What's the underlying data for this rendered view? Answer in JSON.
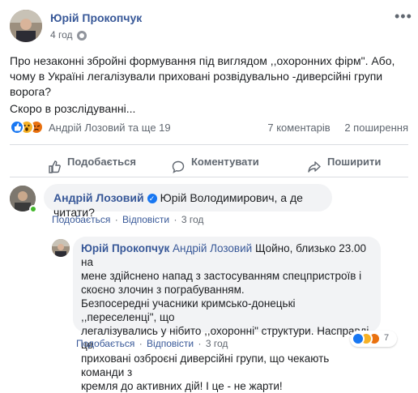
{
  "post": {
    "author": "Юрій Прокопчук",
    "time": "4 год",
    "text_lines": [
      "Про незаконні збройні формування під виглядом ,,охоронних фірм\". Або,",
      "чому в Україні легалізували приховані розвідувально -диверсійні групи",
      "ворога?",
      "Скоро в розслідуванні..."
    ],
    "reactors": "Андрій Лозовий та ще 19",
    "comments_count": "7 коментарів",
    "shares_count": "2 поширення"
  },
  "actions": {
    "like": "Подобається",
    "comment": "Коментувати",
    "share": "Поширити"
  },
  "comment1": {
    "author": "Андрій Лозовий",
    "text": "Юрій Володимирович, а де читати?",
    "like": "Подобається",
    "reply": "Відповісти",
    "time": "3 год"
  },
  "reply1": {
    "author": "Юрій Прокопчук",
    "mention": "Андрій Лозовий",
    "lines": [
      "Щойно, близько 23.00 на",
      "мене здійснено напад з застосуванням спецпристроїв і",
      "скоєно злочин з пограбуванням.",
      "Безпосередні учасники кримсько-донецькі ,,переселенці\", що",
      "легалізувались у нібито ,,охоронні\" структури. Насправді, це",
      "приховані озброєні диверсійні групи, що чекають команди з",
      "кремля до активних дій! І це - не жарти!"
    ],
    "reaction_count": "7",
    "like": "Подобається",
    "reply": "Відповісти",
    "time": "3 год"
  },
  "colors": {
    "link": "#385898",
    "muted": "#606770",
    "like_blue": "#1877f2"
  }
}
